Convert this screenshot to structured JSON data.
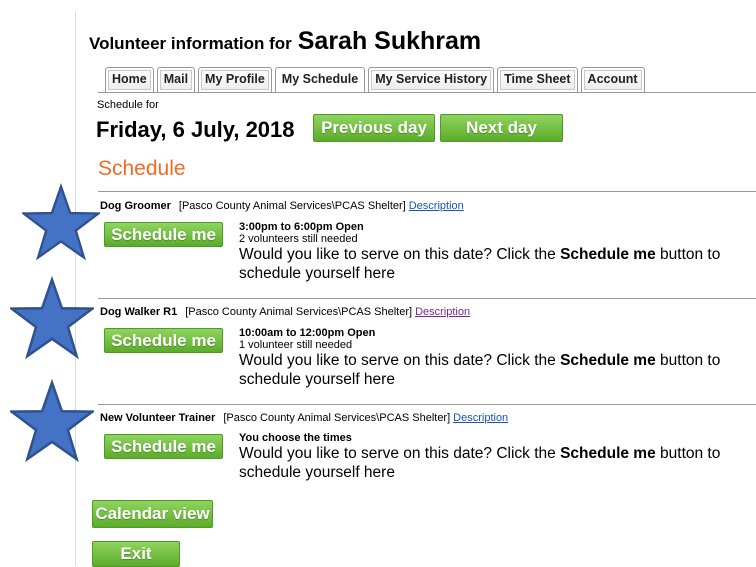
{
  "header": {
    "prefix": "Volunteer information for",
    "volunteer_name": "Sarah Sukhram"
  },
  "tabs": [
    {
      "label": "Home",
      "active": false
    },
    {
      "label": "Mail",
      "active": false
    },
    {
      "label": "My Profile",
      "active": false
    },
    {
      "label": "My Schedule",
      "active": true
    },
    {
      "label": "My Service History",
      "active": false
    },
    {
      "label": "Time Sheet",
      "active": false
    },
    {
      "label": "Account",
      "active": false
    }
  ],
  "schedule_for_label": "Schedule for",
  "date": "Friday, 6 July, 2018",
  "nav": {
    "previous": "Previous day",
    "next": "Next day"
  },
  "section_title": "Schedule",
  "shifts": [
    {
      "role": "Dog Groomer",
      "org": "[Pasco County Animal Services\\PCAS Shelter]",
      "description_link": "Description",
      "button": "Schedule me",
      "time": "3:00pm to 6:00pm Open",
      "needed": "2 volunteers still needed",
      "prompt_before": "Would you like to serve on this date? Click the",
      "prompt_bold": "Schedule me",
      "prompt_after": "button to",
      "prompt_line2": "schedule yourself here"
    },
    {
      "role": "Dog Walker R1",
      "org": "[Pasco County Animal Services\\PCAS Shelter]",
      "description_link": "Description",
      "button": "Schedule me",
      "time": "10:00am to 12:00pm Open",
      "needed": "1 volunteer still needed",
      "prompt_before": "Would you like to serve on this date? Click the",
      "prompt_bold": "Schedule me",
      "prompt_after": "button to",
      "prompt_line2": "schedule yourself here"
    },
    {
      "role": "New Volunteer Trainer",
      "org": "[Pasco County Animal Services\\PCAS Shelter]",
      "description_link": "Description",
      "button": "Schedule me",
      "time": "You choose the times",
      "prompt_before": "Would you like to serve on this date? Click the",
      "prompt_bold": "Schedule me",
      "prompt_after": "button to",
      "prompt_line2": "schedule yourself here"
    }
  ],
  "footer": {
    "calendar": "Calendar view",
    "exit": "Exit"
  },
  "colors": {
    "button_green": "#6cbf3a",
    "section_orange": "#f26b21",
    "link_blue": "#1a55b8",
    "star_blue": "#4472c4"
  }
}
